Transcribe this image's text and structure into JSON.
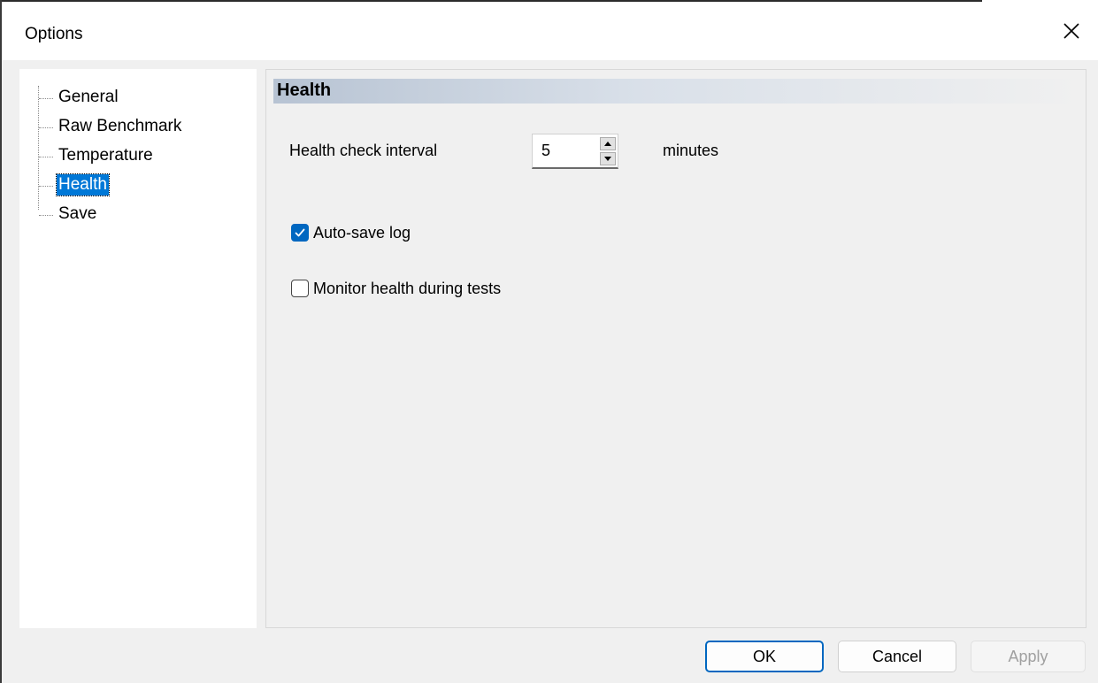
{
  "window": {
    "title": "Options",
    "close_icon": "close-icon"
  },
  "tree": {
    "items": [
      {
        "label": "General",
        "selected": false
      },
      {
        "label": "Raw Benchmark",
        "selected": false
      },
      {
        "label": "Temperature",
        "selected": false
      },
      {
        "label": "Health",
        "selected": true
      },
      {
        "label": "Save",
        "selected": false
      }
    ]
  },
  "panel": {
    "header": "Health",
    "interval": {
      "label": "Health check interval",
      "value": "5",
      "unit": "minutes"
    },
    "autosave": {
      "label": "Auto-save log",
      "checked": true
    },
    "monitor": {
      "label": "Monitor health during tests",
      "checked": false
    }
  },
  "buttons": {
    "ok": "OK",
    "cancel": "Cancel",
    "apply": "Apply"
  },
  "colors": {
    "accent": "#0067c0",
    "selection": "#0078d7"
  }
}
